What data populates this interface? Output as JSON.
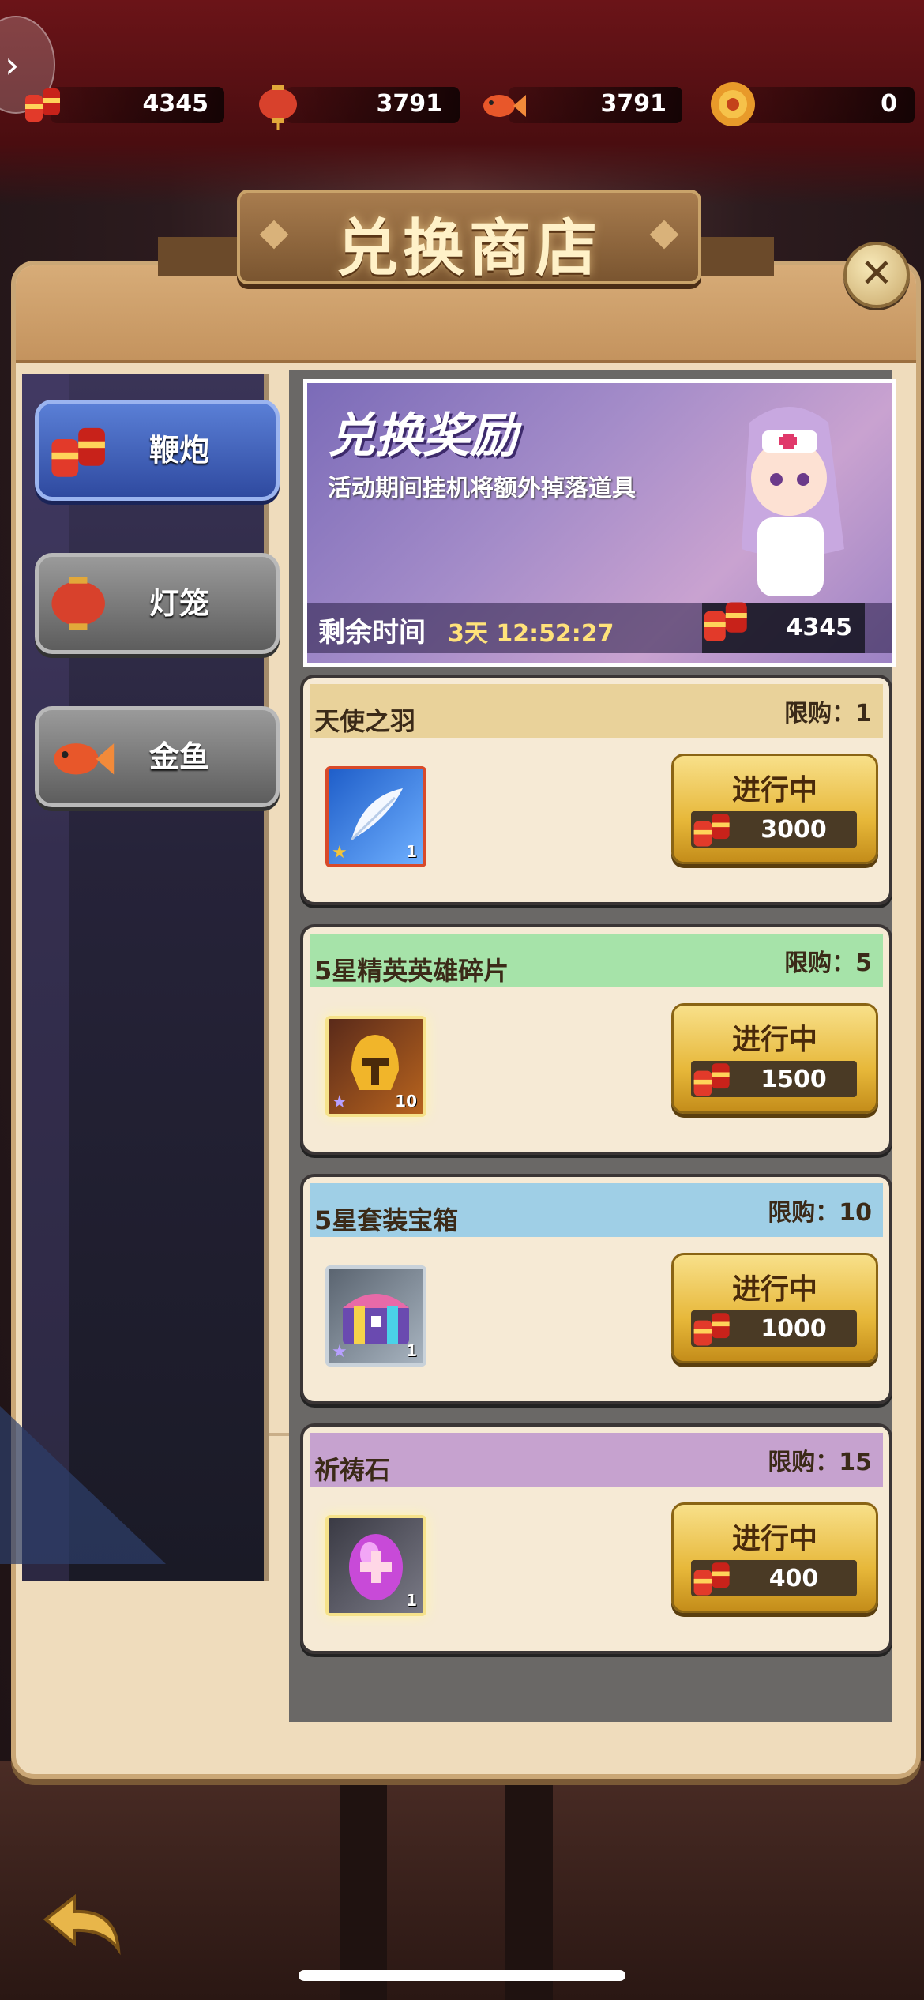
{
  "currencies": [
    {
      "icon": "firecracker-icon",
      "value": "4345"
    },
    {
      "icon": "lantern-icon",
      "value": "3791"
    },
    {
      "icon": "goldfish-icon",
      "value": "3791"
    },
    {
      "icon": "gold-coin-icon",
      "value": "0"
    }
  ],
  "header": {
    "title": "兑换商店"
  },
  "sidebar": {
    "items": [
      {
        "label": "鞭炮",
        "icon": "firecracker-icon",
        "active": true
      },
      {
        "label": "灯笼",
        "icon": "lantern-icon",
        "active": false
      },
      {
        "label": "金鱼",
        "icon": "goldfish-icon",
        "active": false
      }
    ]
  },
  "hero": {
    "title": "兑换奖励",
    "subtitle": "活动期间挂机将额外掉落道具",
    "time_label": "剩余时间",
    "time_value": "3天 12:52:27",
    "currency_value": "4345"
  },
  "items": [
    {
      "name": "天使之羽",
      "limit": "限购：1",
      "count": "1",
      "button": "进行中",
      "price": "3000",
      "header_color": "#e9d29a",
      "icon": "feather-icon"
    },
    {
      "name": "5星精英英雄碎片",
      "limit": "限购：5",
      "count": "10",
      "button": "进行中",
      "price": "1500",
      "header_color": "#a6e3a9",
      "icon": "hero-helmet-icon"
    },
    {
      "name": "5星套装宝箱",
      "limit": "限购：10",
      "count": "1",
      "button": "进行中",
      "price": "1000",
      "header_color": "#9fcfe6",
      "icon": "treasure-chest-icon"
    },
    {
      "name": "祈祷石",
      "limit": "限购：15",
      "count": "1",
      "button": "进行中",
      "price": "400",
      "header_color": "#c6a2cf",
      "icon": "prayer-stone-icon"
    }
  ]
}
